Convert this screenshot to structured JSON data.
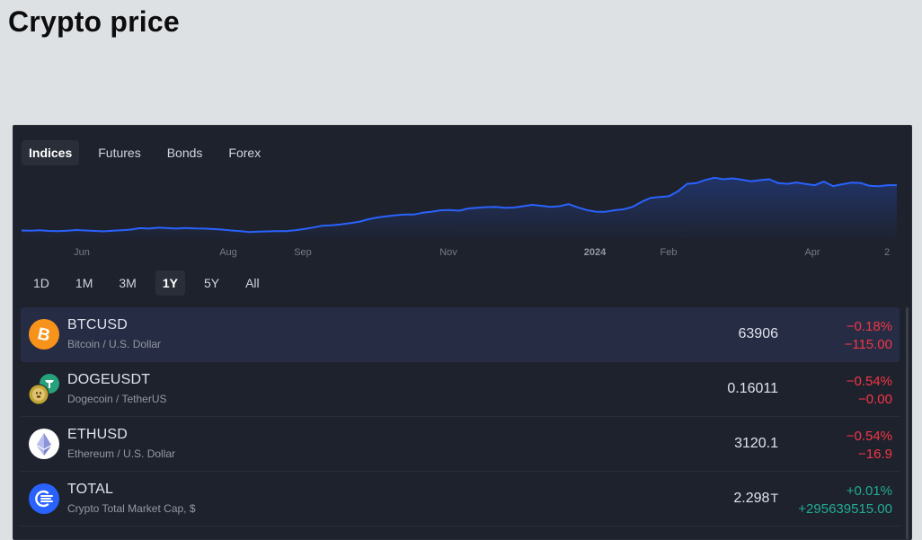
{
  "page": {
    "title": "Crypto price"
  },
  "tabs": [
    {
      "label": "Indices",
      "active": true
    },
    {
      "label": "Futures",
      "active": false
    },
    {
      "label": "Bonds",
      "active": false
    },
    {
      "label": "Forex",
      "active": false
    }
  ],
  "chart_data": {
    "type": "area",
    "series": [
      {
        "values": [
          30.2,
          30.1,
          30.3,
          30.0,
          29.9,
          30.1,
          30.4,
          30.2,
          30.0,
          29.8,
          30.1,
          30.3,
          30.6,
          31.2,
          31.0,
          31.4,
          31.2,
          31.0,
          31.3,
          31.1,
          31.0,
          30.8,
          30.6,
          30.2,
          29.9,
          29.5,
          29.7,
          29.8,
          29.9,
          29.9,
          30.3,
          30.8,
          31.5,
          32.3,
          32.5,
          32.9,
          33.4,
          34.0,
          35.1,
          35.9,
          36.4,
          36.9,
          37.2,
          37.2,
          38.0,
          38.5,
          39.1,
          39.2,
          38.9,
          39.9,
          40.2,
          40.5,
          40.6,
          40.2,
          40.3,
          40.9,
          41.5,
          41.1,
          40.6,
          40.9,
          41.8,
          40.4,
          39.2,
          38.5,
          38.4,
          39.1,
          39.5,
          40.6,
          42.8,
          44.6,
          45.0,
          45.3,
          47.5,
          50.8,
          51.1,
          52.5,
          53.5,
          52.8,
          53.2,
          52.6,
          51.9,
          52.4,
          52.8,
          51.1,
          50.8,
          51.4,
          50.7,
          50.2,
          51.8,
          49.8,
          50.6,
          51.3,
          51.2,
          49.9,
          49.7,
          50.2,
          50.2
        ]
      }
    ],
    "x_ticks": [
      "Jun",
      "Aug",
      "Sep",
      "Nov",
      "2024",
      "Feb",
      "Apr",
      "2"
    ],
    "grid": false,
    "line_color": "#2962ff",
    "fill_color": "#2962ff"
  },
  "ranges": [
    {
      "label": "1D",
      "active": false
    },
    {
      "label": "1M",
      "active": false
    },
    {
      "label": "3M",
      "active": false
    },
    {
      "label": "1Y",
      "active": true
    },
    {
      "label": "5Y",
      "active": false
    },
    {
      "label": "All",
      "active": false
    }
  ],
  "symbols": [
    {
      "name": "BTCUSD",
      "desc": "Bitcoin / U.S. Dollar",
      "price": "63906",
      "unit": "",
      "chg_pct": "−0.18%",
      "chg_abs": "−115.00",
      "direction": "neg",
      "icon": "bitcoin-icon",
      "active": true
    },
    {
      "name": "DOGEUSDT",
      "desc": "Dogecoin / TetherUS",
      "price": "0.16011",
      "unit": "",
      "chg_pct": "−0.54%",
      "chg_abs": "−0.00",
      "direction": "neg",
      "icon": "dogecoin-tether-icon",
      "active": false
    },
    {
      "name": "ETHUSD",
      "desc": "Ethereum / U.S. Dollar",
      "price": "3120.1",
      "unit": "",
      "chg_pct": "−0.54%",
      "chg_abs": "−16.9",
      "direction": "neg",
      "icon": "ethereum-icon",
      "active": false
    },
    {
      "name": "TOTAL",
      "desc": "Crypto Total Market Cap, $",
      "price": "2.298",
      "unit": "T",
      "chg_pct": "+0.01%",
      "chg_abs": "+295639515.00",
      "direction": "pos",
      "icon": "total-market-cap-icon",
      "active": false
    }
  ],
  "colors": {
    "positive": "#22ab94",
    "negative": "#f23645",
    "accent": "#2962ff",
    "panel": "#1e222d"
  }
}
